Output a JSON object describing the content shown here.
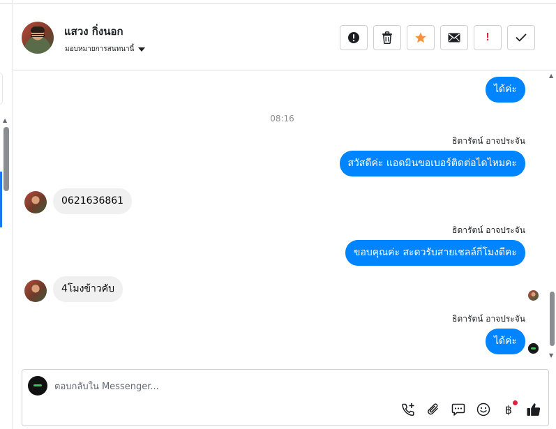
{
  "header": {
    "contact_name": "แสวง กิ่งนอก",
    "assign_label": "มอบหมายการสนทนานี้",
    "toolbar": [
      {
        "name": "report-button",
        "icon": "exclamation-circle-icon"
      },
      {
        "name": "delete-button",
        "icon": "trash-icon"
      },
      {
        "name": "star-button",
        "icon": "star-icon",
        "color": "#f7923b"
      },
      {
        "name": "mark-unread-button",
        "icon": "envelope-icon"
      },
      {
        "name": "mark-important-button",
        "icon": "exclamation-icon",
        "color": "#e41e3f"
      },
      {
        "name": "mark-done-button",
        "icon": "checkmark-icon"
      }
    ],
    "important_glyph": "!"
  },
  "messages": [
    {
      "dir": "out",
      "text": "ได้ค่ะ"
    },
    {
      "type": "time",
      "text": "08:16"
    },
    {
      "dir": "out",
      "sender": "ธิดารัตน์ อาจประจัน",
      "text": "สวัสดีค่ะ แอดมินขอเบอร์ติดต่อไดไหมคะ"
    },
    {
      "dir": "in",
      "text": "0621636861"
    },
    {
      "dir": "out",
      "sender": "ธิดารัตน์ อาจประจัน",
      "text": "ขอบคุณค่ะ สะดวรับสายเชลล์กี่โมงดีคะ"
    },
    {
      "dir": "in",
      "text": "4โมงข้าวคับ"
    },
    {
      "dir": "out",
      "sender": "ธิดารัตน์ อาจประจัน",
      "text": "ได้ค่ะ"
    }
  ],
  "composer": {
    "placeholder": "ตอบกลับใน Messenger...",
    "tools": [
      "phone-plus-icon",
      "paperclip-icon",
      "chat-bubble-icon",
      "smiley-icon",
      "baht-icon",
      "thumbs-up-icon"
    ],
    "baht_glyph": "฿"
  },
  "colors": {
    "accent": "#0084ff",
    "incoming_bubble": "#f0f0f0",
    "star": "#f7923b",
    "important": "#e41e3f"
  }
}
